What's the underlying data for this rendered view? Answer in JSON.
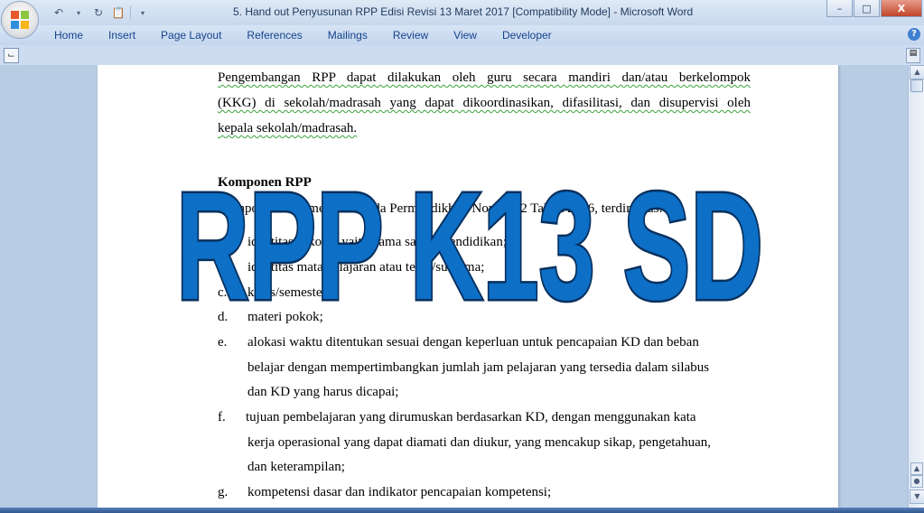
{
  "window": {
    "title": "5. Hand out Penyusunan RPP  Edisi Revisi 13 Maret 2017 [Compatibility Mode] - Microsoft Word",
    "min_label": "–",
    "max_label": "□",
    "close_label": "X"
  },
  "ribbon": {
    "tabs": [
      "Home",
      "Insert",
      "Page Layout",
      "References",
      "Mailings",
      "Review",
      "View",
      "Developer"
    ],
    "help_label": "?"
  },
  "document": {
    "intro_lines": [
      "Pengembangan RPP dapat dilakukan oleh guru secara mandiri dan/atau berkelompok",
      "(KKG) di sekolah/madrasah yang dapat dikoordinasikan, difasilitasi, dan disupervisi oleh",
      "kepala sekolah/madrasah."
    ],
    "heading": "Komponen RPP",
    "lead": "Komponen RPP mengacu pada Permendikbud Nomor 22 Tahun 2016, terdiri atas:",
    "list": [
      {
        "marker": "a.",
        "lines": [
          "identitas sekolah yaitu nama satuan pendidikan;"
        ]
      },
      {
        "marker": "b.",
        "lines": [
          "identitas mata pelajaran  atau tema/subtema;"
        ]
      },
      {
        "marker": "c.",
        "lines": [
          "kelas/semester;"
        ]
      },
      {
        "marker": "d.",
        "lines": [
          "materi pokok;"
        ]
      },
      {
        "marker": "e.",
        "lines": [
          "alokasi waktu ditentukan sesuai  dengan keperluan  untuk pencapaian  KD dan beban",
          "belajar  dengan mempertimbangkan  jumlah jam pelajaran  yang tersedia dalam silabus",
          "dan KD yang harus  dicapai;"
        ]
      },
      {
        "marker": "f.",
        "lines": [
          "tujuan pembelajaran  yang dirumuskan berdasarkan KD, dengan menggunakan kata",
          "kerja operasional  yang dapat diamati dan diukur, yang mencakup sikap, pengetahuan,",
          "dan keterampilan;"
        ]
      },
      {
        "marker": "g.",
        "lines": [
          "kompetensi dasar dan indikator pencapaian kompetensi;"
        ]
      }
    ]
  },
  "overlay": {
    "text": "RPP K13 SD",
    "fill": "#0d6fc6",
    "stroke": "#07305e"
  },
  "scrollbar": {
    "up": "▲",
    "down": "▼"
  }
}
